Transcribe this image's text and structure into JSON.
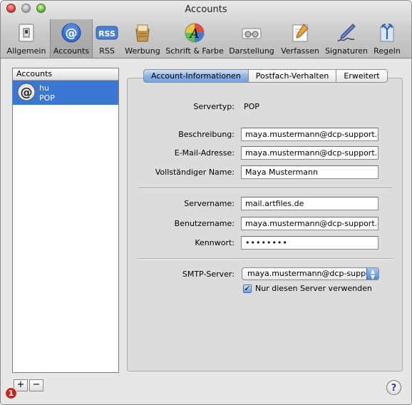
{
  "window": {
    "title": "Accounts"
  },
  "toolbar": {
    "items": [
      {
        "label": "Allgemein",
        "icon": "switch-icon"
      },
      {
        "label": "Accounts",
        "icon": "at-icon"
      },
      {
        "label": "RSS",
        "icon": "rss-icon"
      },
      {
        "label": "Werbung",
        "icon": "junk-mail-icon"
      },
      {
        "label": "Schrift & Farbe",
        "icon": "font-color-icon"
      },
      {
        "label": "Darstellung",
        "icon": "viewing-glasses-icon"
      },
      {
        "label": "Verfassen",
        "icon": "compose-pencil-icon"
      },
      {
        "label": "Signaturen",
        "icon": "signature-pen-icon"
      },
      {
        "label": "Regeln",
        "icon": "rules-icon"
      }
    ],
    "selected": "Accounts"
  },
  "accounts_list": {
    "header": "Accounts",
    "items": [
      {
        "name": "hu",
        "type": "POP"
      }
    ]
  },
  "controls": {
    "add": "+",
    "remove": "−",
    "help": "?",
    "badge": "1"
  },
  "tabs": [
    {
      "label": "Account-Informationen"
    },
    {
      "label": "Postfach-Verhalten"
    },
    {
      "label": "Erweitert"
    }
  ],
  "form": {
    "servertyp_label": "Servertyp:",
    "servertyp_value": "POP",
    "beschreibung_label": "Beschreibung:",
    "beschreibung_value": "maya.mustermann@dcp-support.d",
    "email_label": "E-Mail-Adresse:",
    "email_value": "maya.mustermann@dcp-support.d",
    "name_label": "Vollständiger Name:",
    "name_value": "Maya Mustermann",
    "servername_label": "Servername:",
    "servername_value": "mail.artfiles.de",
    "benutzername_label": "Benutzername:",
    "benutzername_value": "maya.mustermann@dcp-support.d",
    "kennwort_label": "Kennwort:",
    "kennwort_value": "••••••••",
    "smtp_label": "SMTP-Server:",
    "smtp_value": "maya.mustermann@dcp-suppo",
    "only_server_label": "Nur diesen Server verwenden",
    "only_server_checked": true
  },
  "colors": {
    "selection": "#3b78d6",
    "badge": "#c6261b"
  }
}
